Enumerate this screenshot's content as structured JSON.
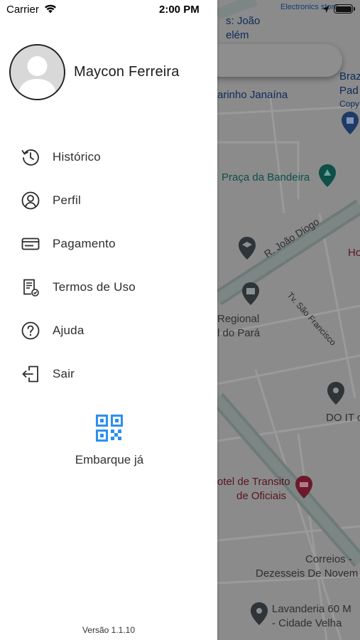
{
  "status_bar": {
    "carrier": "Carrier",
    "time": "2:00 PM",
    "right_label": "Electronics store"
  },
  "user": {
    "name": "Maycon Ferreira"
  },
  "menu": {
    "items": [
      {
        "label": "Histórico",
        "icon": "history-icon"
      },
      {
        "label": "Perfil",
        "icon": "profile-icon"
      },
      {
        "label": "Pagamento",
        "icon": "payment-card-icon"
      },
      {
        "label": "Termos de Uso",
        "icon": "terms-document-icon"
      },
      {
        "label": "Ajuda",
        "icon": "help-icon"
      },
      {
        "label": "Sair",
        "icon": "logout-icon"
      }
    ]
  },
  "qr": {
    "label": "Embarque já",
    "icon": "qr-code-icon",
    "color": "#2d8ff0"
  },
  "footer": {
    "version": "Versão 1.1.10"
  },
  "map": {
    "labels": {
      "joao_line1": "s: João",
      "joao_line2": "elém",
      "janaina": "arinho Janaína",
      "braz1": "Braz",
      "braz2": "Pad",
      "braz3": "Copy",
      "praca": "Praça da Bandeira",
      "ho": "Ho",
      "rua_joao_diogo": "R. João Diogo",
      "regional1": "Regional",
      "regional2": "l do Pará",
      "tv_sao_francisco": "Tv. São Francisco",
      "doit": "DO IT c",
      "hotel1": "otel de Transito",
      "hotel2": "de Oficiais",
      "correios1": "Correios -",
      "correios2": "Dezesseis De Novem",
      "lavanderia1": "Lavanderia 60 M",
      "lavanderia2": "- Cidade Velha"
    }
  }
}
